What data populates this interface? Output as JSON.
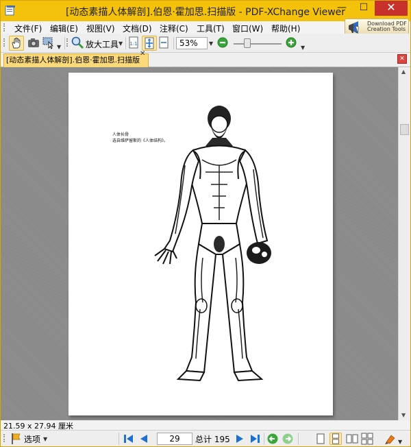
{
  "window": {
    "title": "[动态素描人体解剖].伯恩·霍加思.扫描版 - PDF-XChange Viewer",
    "minimize": "—",
    "maximize": "☐",
    "close": "✕"
  },
  "menu": {
    "items": [
      "文件(F)",
      "编辑(E)",
      "视图(V)",
      "文档(D)",
      "注释(C)",
      "工具(T)",
      "窗口(W)",
      "帮助(H)"
    ]
  },
  "promo": {
    "line1": "Download PDF",
    "line2": "Creation Tools"
  },
  "toolbar": {
    "zoom_tool_label": "放大工具",
    "zoom_value": "53%",
    "zoom_level": 0.25,
    "icons": [
      "hand-tool-icon",
      "snapshot-icon",
      "select-icon",
      "zoom-tool-icon",
      "actual-size-icon",
      "fit-page-icon",
      "fit-width-icon",
      "zoom-out-icon",
      "zoom-in-icon"
    ]
  },
  "tabs": {
    "document_tab": "[动态素描人体解剖].伯恩·霍加思.扫描版",
    "tab_close": "✕",
    "panel_close": "✕"
  },
  "page": {
    "caption_line1": "人体长骨",
    "caption_line2": "选自维萨留斯的《人体结构》。"
  },
  "status": {
    "page_size": "21.59 x 27.94 厘米"
  },
  "navigation": {
    "options_label": "选项",
    "current_page": "29",
    "total_pages": "总计 195"
  },
  "colors": {
    "title_bar": "#f4c20d",
    "close_button": "#c7302b",
    "active_tab": "#fcd97a",
    "nav_arrows": "#1e6fd0",
    "zoom_green": "#3aa63a"
  }
}
